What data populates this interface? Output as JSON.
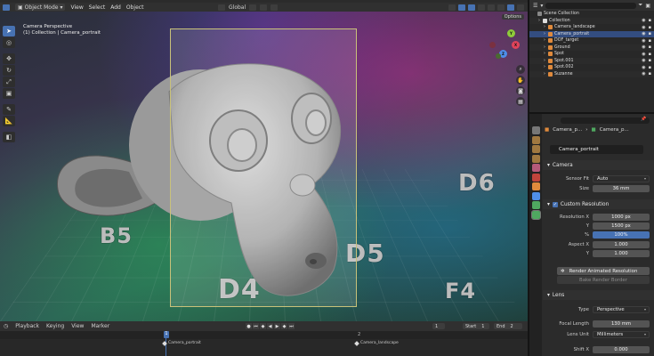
{
  "header": {
    "mode_label": "Object Mode",
    "menus": [
      "View",
      "Select",
      "Add",
      "Object"
    ],
    "orientation_label": "Global",
    "options_label": "Options"
  },
  "viewport": {
    "info_line1": "Camera Perspective",
    "info_line2": "(1) Collection | Camera_portrait",
    "tile_labels": [
      "B5",
      "D5",
      "D4",
      "D6",
      "F4"
    ]
  },
  "gizmo": {
    "x": "X",
    "y": "Y",
    "z": "Z"
  },
  "timeline": {
    "menus": [
      "Playback",
      "Keying",
      "View",
      "Marker"
    ],
    "current_frame": "1",
    "start_label": "Start",
    "start_value": "1",
    "end_label": "End",
    "end_value": "2",
    "ruler_numbers": [
      "1",
      "2"
    ],
    "markers": [
      "Camera_portrait",
      "Camera_landscape"
    ]
  },
  "outliner": {
    "items": [
      {
        "label": "Scene Collection",
        "indent": 0,
        "color": "#888888",
        "visible": false
      },
      {
        "label": "Collection",
        "indent": 1,
        "color": "#dddddd",
        "visible": true
      },
      {
        "label": "Camera_landscape",
        "indent": 2,
        "color": "#e08a3c",
        "visible": true
      },
      {
        "label": "Camera_portrait",
        "indent": 2,
        "color": "#e08a3c",
        "visible": true,
        "selected": true
      },
      {
        "label": "DOF_target",
        "indent": 2,
        "color": "#e08a3c",
        "visible": true
      },
      {
        "label": "Ground",
        "indent": 2,
        "color": "#e08a3c",
        "visible": true
      },
      {
        "label": "Spot",
        "indent": 2,
        "color": "#e08a3c",
        "visible": true
      },
      {
        "label": "Spot.001",
        "indent": 2,
        "color": "#e08a3c",
        "visible": true
      },
      {
        "label": "Spot.002",
        "indent": 2,
        "color": "#e08a3c",
        "visible": true
      },
      {
        "label": "Suzanne",
        "indent": 2,
        "color": "#e08a3c",
        "visible": true
      }
    ]
  },
  "properties": {
    "breadcrumb": [
      "Camera_p...",
      "Camera_p..."
    ],
    "datablock_name": "Camera_portrait",
    "camera_panel": {
      "title": "Camera",
      "sensor_fit_label": "Sensor Fit",
      "sensor_fit_value": "Auto",
      "size_label": "Size",
      "size_value": "36 mm"
    },
    "custom_res_panel": {
      "title": "Custom Resolution",
      "res_x_label": "Resolution X",
      "res_x_value": "1000 px",
      "res_y_label": "Y",
      "res_y_value": "1500 px",
      "res_pct_label": "%",
      "res_pct_value": "100%",
      "aspect_x_label": "Aspect X",
      "aspect_x_value": "1.000",
      "aspect_y_label": "Y",
      "aspect_y_value": "1.000"
    },
    "render_animated_label": "Render Animated Resolution",
    "bake_render_border_label": "Bake Render Border",
    "lens_panel": {
      "title": "Lens",
      "type_label": "Type",
      "type_value": "Perspective",
      "focal_label": "Focal Length",
      "focal_value": "130 mm",
      "lens_unit_label": "Lens Unit",
      "lens_unit_value": "Millimeters",
      "shift_x_label": "Shift X",
      "shift_x_value": "0.000"
    }
  },
  "colors": {
    "accent": "#4772b3",
    "panel_bg": "#2b2b2b",
    "camera_frame": "#c9c27a"
  }
}
